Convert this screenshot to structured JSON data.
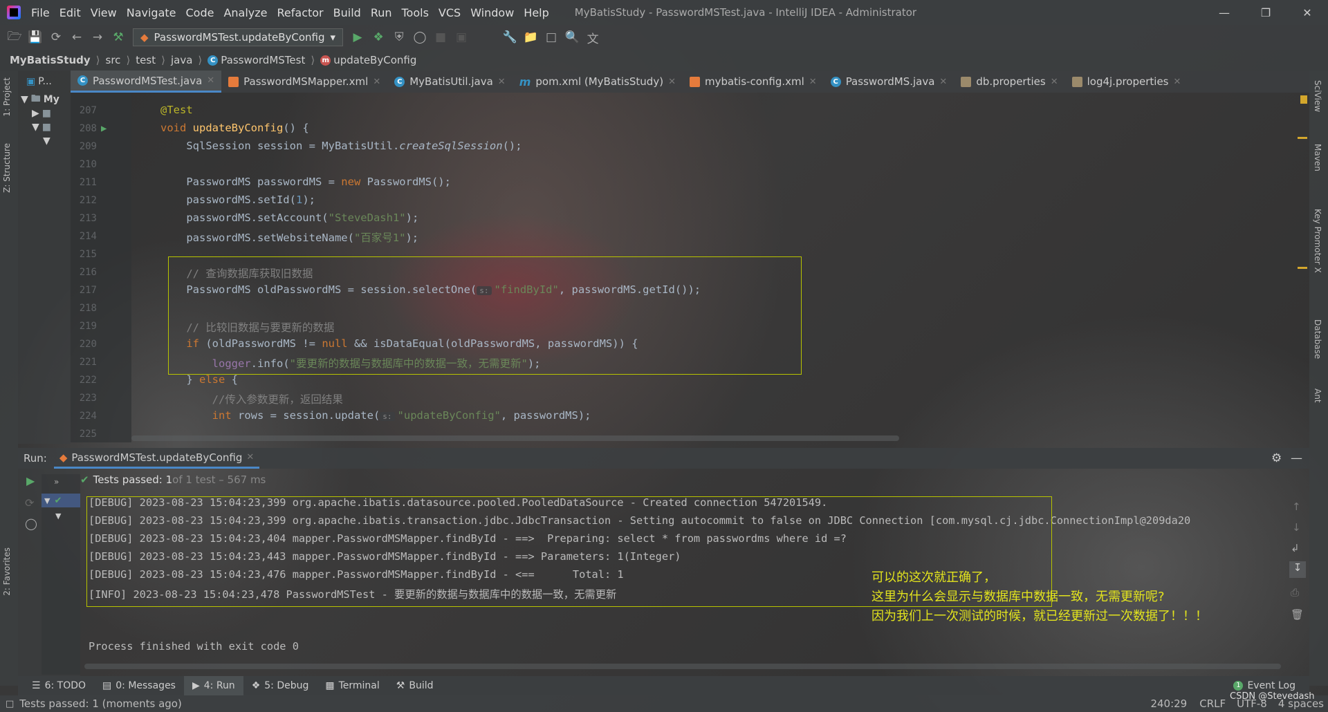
{
  "menu": [
    "File",
    "Edit",
    "View",
    "Navigate",
    "Code",
    "Analyze",
    "Refactor",
    "Build",
    "Run",
    "Tools",
    "VCS",
    "Window",
    "Help"
  ],
  "window_title": "MyBatisStudy - PasswordMSTest.java - IntelliJ IDEA - Administrator",
  "run_config": "PasswordMSTest.updateByConfig",
  "breadcrumb": [
    "MyBatisStudy",
    "src",
    "test",
    "java",
    "PasswordMSTest",
    "updateByConfig"
  ],
  "project_panel": {
    "label": "P...",
    "root": "My"
  },
  "tabs": [
    "PasswordMSTest.java",
    "PasswordMSMapper.xml",
    "MyBatisUtil.java",
    "pom.xml (MyBatisStudy)",
    "mybatis-config.xml",
    "PasswordMS.java",
    "db.properties",
    "log4j.properties"
  ],
  "left_tools": [
    "1: Project",
    "Z: Structure",
    "2: Favorites"
  ],
  "right_tools": [
    "SciView",
    "Maven",
    "Key Promoter X",
    "Database",
    "Ant"
  ],
  "code": {
    "line_numbers": [
      "207",
      "208",
      "209",
      "210",
      "211",
      "212",
      "213",
      "214",
      "215",
      "216",
      "217",
      "218",
      "219",
      "220",
      "221",
      "222",
      "223",
      "224",
      "225"
    ],
    "l207": "@Test",
    "l208_kw": "void",
    "l208_fn": "updateByConfig",
    "l208_rest": "() {",
    "l209_a": "    SqlSession session = MyBatisUtil.",
    "l209_b": "createSqlSession",
    "l209_c": "();",
    "l211_a": "    PasswordMS passwordMS = ",
    "l211_kw": "new",
    "l211_b": " PasswordMS();",
    "l212_a": "    passwordMS.setId(",
    "l212_num": "1",
    "l212_b": ");",
    "l213_a": "    passwordMS.setAccount(",
    "l213_st": "\"SteveDash1\"",
    "l213_b": ");",
    "l214_a": "    passwordMS.setWebsiteName(",
    "l214_st": "\"百家号1\"",
    "l214_b": ");",
    "l216": "    // 查询数据库获取旧数据",
    "l217_a": "    PasswordMS oldPasswordMS = session.selectOne(",
    "l217_hint": "s:",
    "l217_st": "\"findById\"",
    "l217_b": ", passwordMS.getId());",
    "l219": "    // 比较旧数据与要更新的数据",
    "l220_kw": "    if",
    "l220_a": " (oldPasswordMS != ",
    "l220_null": "null",
    "l220_b": " && isDataEqual(oldPasswordMS, passwordMS)) {",
    "l221_fld": "        logger",
    "l221_a": ".info(",
    "l221_st": "\"要更新的数据与数据库中的数据一致，无需更新\"",
    "l221_b": ");",
    "l222_a": "    } ",
    "l222_kw": "else",
    "l222_b": " {",
    "l223": "        //传入参数更新，返回结果",
    "l224_kw": "        int",
    "l224_a": " rows = session.update(",
    "l224_hint": "s:",
    "l224_st": "\"updateByConfig\"",
    "l224_b": ", passwordMS);"
  },
  "run": {
    "label": "Run:",
    "tab": "PasswordMSTest.updateByConfig",
    "status_bold": "Tests passed: 1",
    "status_rest": " of 1 test – 567 ms",
    "console": [
      "[DEBUG] 2023-08-23 15:04:23,399 org.apache.ibatis.datasource.pooled.PooledDataSource - Created connection 547201549.",
      "[DEBUG] 2023-08-23 15:04:23,399 org.apache.ibatis.transaction.jdbc.JdbcTransaction - Setting autocommit to false on JDBC Connection [com.mysql.cj.jdbc.ConnectionImpl@209da20",
      "[DEBUG] 2023-08-23 15:04:23,404 mapper.PasswordMSMapper.findById - ==>  Preparing: select * from passwordms where id =?",
      "[DEBUG] 2023-08-23 15:04:23,443 mapper.PasswordMSMapper.findById - ==> Parameters: 1(Integer)",
      "[DEBUG] 2023-08-23 15:04:23,476 mapper.PasswordMSMapper.findById - <==      Total: 1",
      "[INFO] 2023-08-23 15:04:23,478 PasswordMSTest - 要更新的数据与数据库中的数据一致，无需更新",
      "",
      "",
      "Process finished with exit code 0"
    ]
  },
  "annotation": [
    "可以的这次就正确了，",
    "这里为什么会显示与数据库中数据一致，无需更新呢?",
    "因为我们上一次测试的时候，就已经更新过一次数据了！！！"
  ],
  "bottom_tabs": [
    "6: TODO",
    "0: Messages",
    "4: Run",
    "5: Debug",
    "Terminal",
    "Build"
  ],
  "event_log": "Event Log",
  "status": {
    "message": "Tests passed: 1 (moments ago)",
    "position": "240:29",
    "line_sep": "CRLF",
    "encoding": "UTF-8",
    "indent": "4 spaces",
    "watermark": "CSDN @Stevedash"
  },
  "colors": {
    "highlight_box": "#b8c400",
    "annotation": "#e3e41d",
    "accent": "#4a88c7"
  }
}
